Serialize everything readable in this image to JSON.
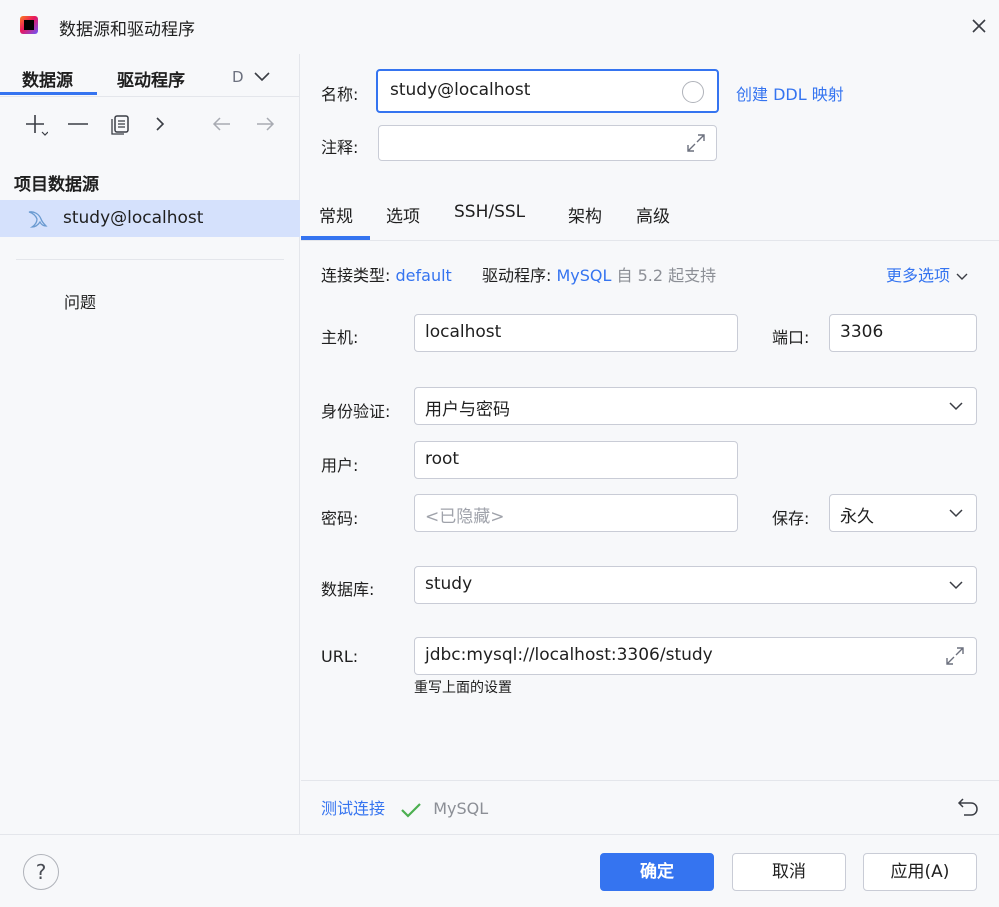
{
  "window": {
    "title": "数据源和驱动程序",
    "close_icon": "close-icon"
  },
  "sidebar": {
    "tabs": [
      "数据源",
      "驱动程序",
      "D"
    ],
    "section_title": "项目数据源",
    "datasource": "study@localhost",
    "problems": "问题"
  },
  "main": {
    "name_label": "名称:",
    "name_value": "study@localhost",
    "ddl_link": "创建 DDL 映射",
    "comment_label": "注释:",
    "comment_value": "",
    "tabs": [
      "常规",
      "选项",
      "SSH/SSL",
      "架构",
      "高级"
    ],
    "conn_type_label": "连接类型:",
    "conn_type_value": "default",
    "driver_label": "驱动程序:",
    "driver_value": "MySQL",
    "driver_note": "自 5.2 起支持",
    "more_options": "更多选项",
    "host_label": "主机:",
    "host_value": "localhost",
    "port_label": "端口:",
    "port_value": "3306",
    "auth_label": "身份验证:",
    "auth_value": "用户与密码",
    "user_label": "用户:",
    "user_value": "root",
    "password_label": "密码:",
    "password_placeholder": "<已隐藏>",
    "save_label": "保存:",
    "save_value": "永久",
    "database_label": "数据库:",
    "database_value": "study",
    "url_label": "URL:",
    "url_value": "jdbc:mysql://localhost:3306/study",
    "url_hint": "重写上面的设置",
    "test_connection": "测试连接",
    "test_result": "MySQL"
  },
  "footer": {
    "help": "?",
    "ok": "确定",
    "cancel": "取消",
    "apply": "应用(A)"
  },
  "colors": {
    "accent": "#3574f0",
    "selection": "#d5e1fc",
    "success": "#4caf50"
  }
}
